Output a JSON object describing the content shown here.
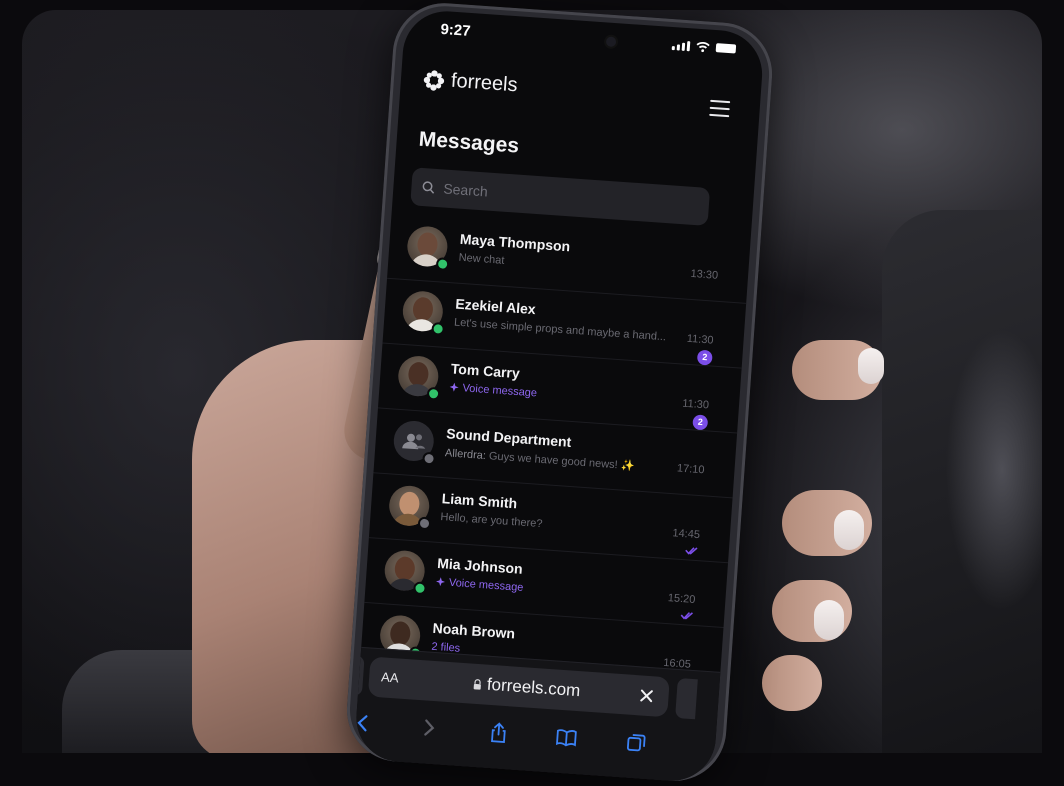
{
  "status_bar": {
    "time": "9:27"
  },
  "app": {
    "logo_text": "forreels"
  },
  "page": {
    "title": "Messages"
  },
  "search": {
    "placeholder": "Search"
  },
  "conversations": [
    {
      "name": "Maya Thompson",
      "preview": "New chat",
      "time": "13:30",
      "presence": "online",
      "skin": "#6b4a3a",
      "shirt": "#d8d0c8"
    },
    {
      "name": "Ezekiel Alex",
      "preview": "Let's use simple props and maybe a hand...",
      "time": "11:30",
      "presence": "online",
      "badge": "2",
      "skin": "#5a3b2c",
      "shirt": "#e9e6e2"
    },
    {
      "name": "Tom Carry",
      "preview": "Voice message",
      "preview_type": "voice",
      "time": "11:30",
      "presence": "online",
      "badge": "2",
      "skin": "#4a3025",
      "shirt": "#3a3a40"
    },
    {
      "name": "Sound Department",
      "preview_sender": "Allerdra:",
      "preview": "Guys we have good news! ✨",
      "time": "17:10",
      "presence": "offline",
      "group": true
    },
    {
      "name": "Liam Smith",
      "preview": "Hello, are you there?",
      "time": "14:45",
      "presence": "offline",
      "read": true,
      "skin": "#c09070",
      "shirt": "#7a5a3a"
    },
    {
      "name": "Mia Johnson",
      "preview": "Voice message",
      "preview_type": "voice",
      "time": "15:20",
      "presence": "online",
      "read": true,
      "skin": "#5c3a2a",
      "shirt": "#2a2a30"
    },
    {
      "name": "Noah Brown",
      "preview": "2 files",
      "preview_type": "files",
      "time": "16:05",
      "presence": "online",
      "read": true,
      "skin": "#3e2a20",
      "shirt": "#e0e0e0"
    }
  ],
  "browser": {
    "text_size_label": "AA",
    "url": "forreels.com"
  },
  "colors": {
    "accent": "#7b4ee8",
    "online": "#31c26a",
    "background": "#0a0a0c"
  }
}
